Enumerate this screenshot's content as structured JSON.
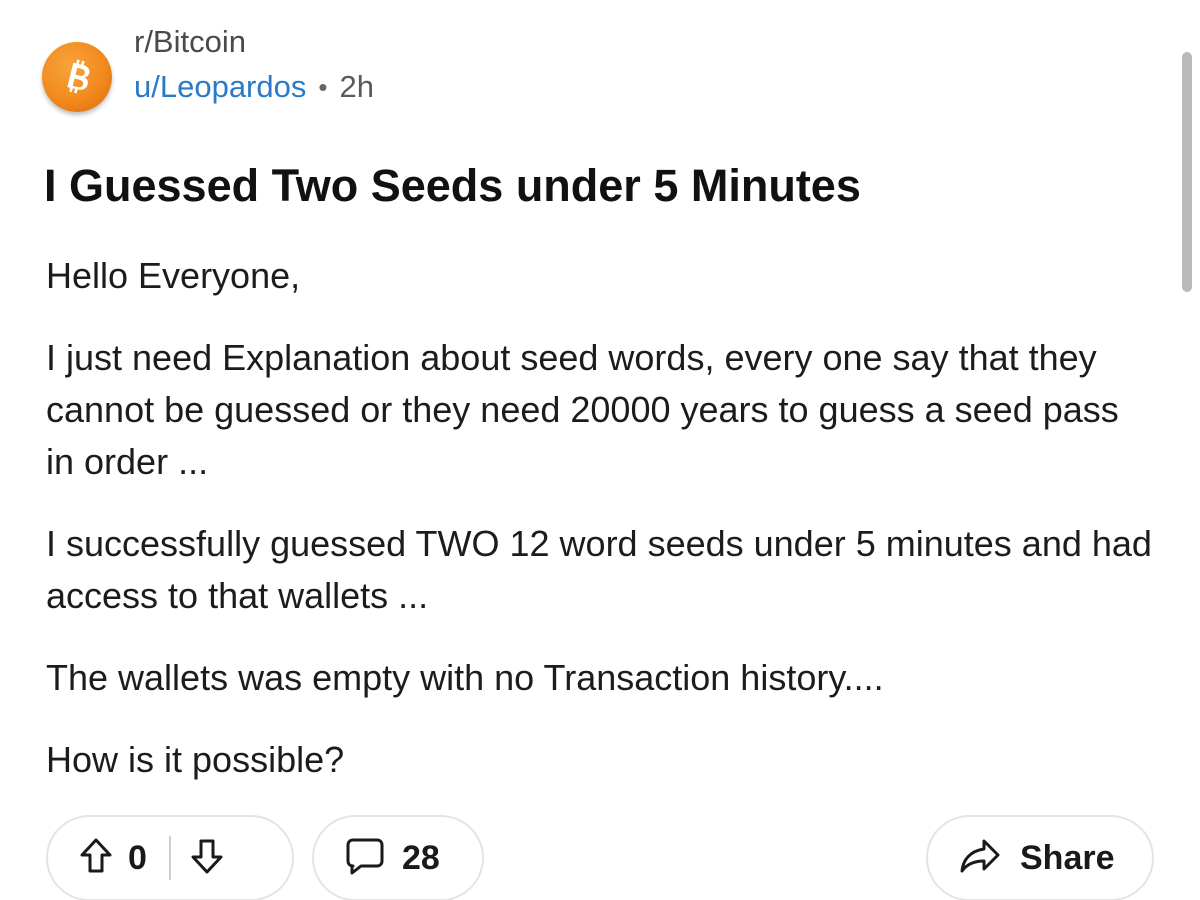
{
  "post": {
    "subreddit": "r/Bitcoin",
    "username": "u/Leopardos",
    "separator": "•",
    "age": "2h",
    "title": "I Guessed Two Seeds under 5 Minutes",
    "paragraphs": [
      "Hello Everyone,",
      "I just need Explanation about seed words, every one say that they cannot be guessed or they need 20000 years to guess a seed pass in order ...",
      "I successfully guessed TWO 12 word seeds under 5 minutes and had access to that wallets ...",
      "The wallets was empty with no Transaction history....",
      "How is it possible?"
    ]
  },
  "actions": {
    "vote_count": "0",
    "comment_count": "28",
    "share_label": "Share"
  },
  "icons": {
    "avatar": "bitcoin-logo-icon",
    "upvote": "arrow-up-icon",
    "downvote": "arrow-down-icon",
    "comment": "speech-bubble-icon",
    "share": "share-arrow-icon"
  },
  "colors": {
    "username": "#2a7ac7",
    "avatar_orange": "#f28a1e",
    "text": "#1a1a1b"
  }
}
